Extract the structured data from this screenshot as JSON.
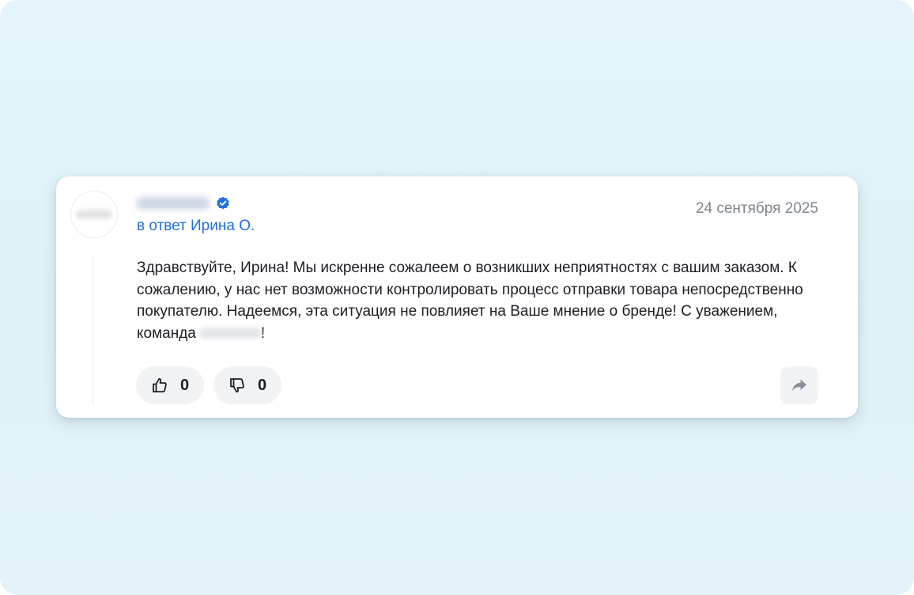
{
  "review_reply": {
    "author": {
      "name": "",
      "verified": true,
      "avatar": "avatar"
    },
    "reply_to": "в ответ Ирина О.",
    "date": "24 сентября 2025",
    "text": "Здравствуйте, Ирина! Мы искренне сожалеем о возникших неприятностях с вашим заказом. К сожалению, у нас нет возможности контролировать процесс отправки товара непосредственно покупателю. Надеемся, эта ситуация не повлияет на Ваше мнение о бренде! С уважением, команда",
    "text_end": "!",
    "likes": "0",
    "dislikes": "0",
    "icons": {
      "verified": "verified-check-icon",
      "like": "thumbs-up-icon",
      "dislike": "thumbs-down-icon",
      "share": "share-arrow-icon"
    },
    "colors": {
      "background": "#e1f3f9",
      "accent": "#1f6fe5",
      "date_text": "#7e858f",
      "button_bg": "#f2f3f5"
    }
  }
}
